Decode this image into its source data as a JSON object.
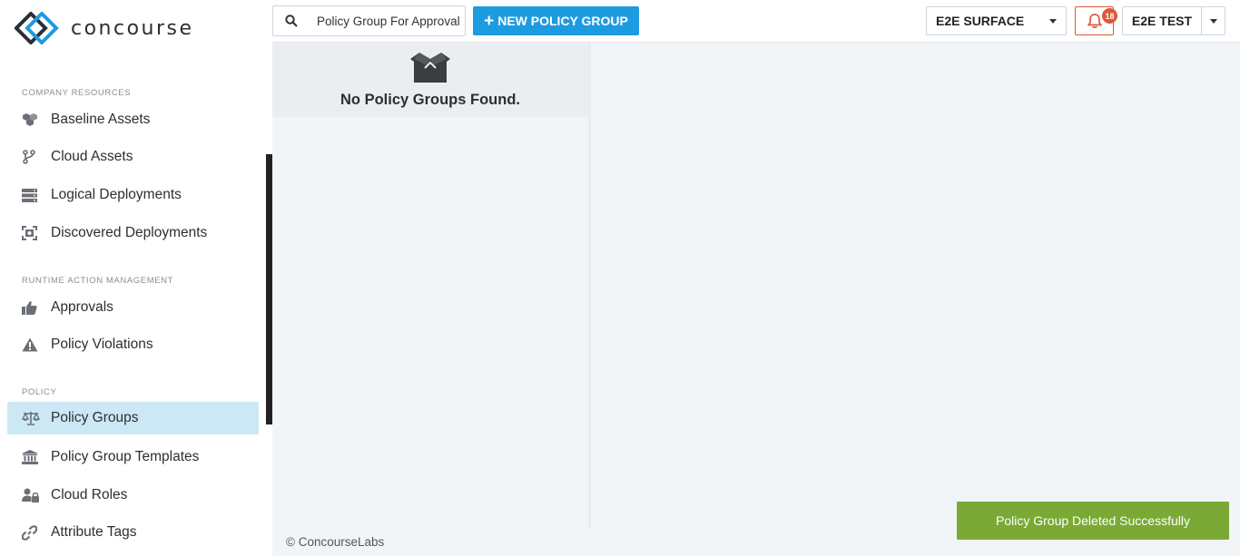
{
  "app": {
    "logo_text": "concourse",
    "brand_color": "#1d9be0"
  },
  "sidebar": {
    "sections": [
      {
        "title": "COMPANY RESOURCES"
      },
      {
        "title": "RUNTIME ACTION MANAGEMENT"
      },
      {
        "title": "POLICY"
      }
    ],
    "items": [
      {
        "label": "Baseline Assets",
        "icon": "cubes-icon"
      },
      {
        "label": "Cloud Assets",
        "icon": "branch-icon"
      },
      {
        "label": "Logical Deployments",
        "icon": "server-icon"
      },
      {
        "label": "Discovered Deployments",
        "icon": "scan-icon"
      },
      {
        "label": "Approvals",
        "icon": "thumbs-up-icon"
      },
      {
        "label": "Policy Violations",
        "icon": "warning-icon"
      },
      {
        "label": "Policy Groups",
        "icon": "balance-scale-icon",
        "active": true
      },
      {
        "label": "Policy Group Templates",
        "icon": "institution-icon"
      },
      {
        "label": "Cloud Roles",
        "icon": "user-lock-icon"
      },
      {
        "label": "Attribute Tags",
        "icon": "link-icon"
      }
    ]
  },
  "topbar": {
    "search_value": "Policy Group For Approval",
    "new_button_label": "NEW POLICY GROUP",
    "environment": "E2E SURFACE",
    "notification_count": "18",
    "user": "E2E TEST"
  },
  "list": {
    "empty_message": "No Policy Groups Found."
  },
  "footer": {
    "copyright": "© ConcourseLabs"
  },
  "toast": {
    "message": "Policy Group Deleted Successfully",
    "color": "#7aaa35"
  }
}
